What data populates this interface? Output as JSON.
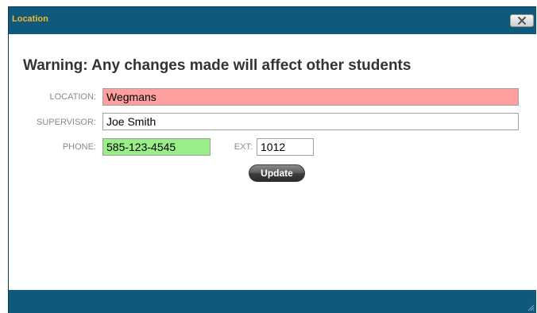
{
  "dialog": {
    "title": "Location",
    "close_icon": "close-x-icon",
    "warning": "Warning: Any changes made will affect other students"
  },
  "form": {
    "location": {
      "label": "LOCATION:",
      "value": "Wegmans",
      "bg": "#ff9f9f"
    },
    "supervisor": {
      "label": "SUPERVISOR:",
      "value": "Joe Smith",
      "bg": "#ffffff"
    },
    "phone": {
      "label": "PHONE:",
      "value": "585-123-4545",
      "bg": "#99ee88"
    },
    "ext": {
      "label": "EXT:",
      "value": "1012"
    },
    "update_label": "Update"
  },
  "colors": {
    "titlebar": "#0f5a7c",
    "title_text": "#f2b632"
  }
}
